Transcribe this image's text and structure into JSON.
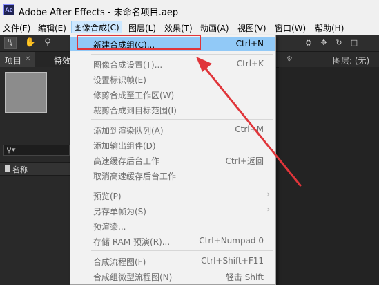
{
  "window": {
    "title": "Adobe After Effects - 未命名项目.aep",
    "app_icon": "Ae"
  },
  "menubar": [
    {
      "label": "文件(F)"
    },
    {
      "label": "编辑(E)"
    },
    {
      "label": "图像合成(C)"
    },
    {
      "label": "图层(L)"
    },
    {
      "label": "效果(T)"
    },
    {
      "label": "动画(A)"
    },
    {
      "label": "视图(V)"
    },
    {
      "label": "窗口(W)"
    },
    {
      "label": "帮助(H)"
    }
  ],
  "tabs": {
    "project": "项目",
    "effects": "特效",
    "layer": "图层: (无)"
  },
  "project_panel": {
    "search_icon": "search-icon",
    "column_name": "名称"
  },
  "menu": [
    {
      "label": "新建合成组(C)...",
      "shortcut": "Ctrl+N",
      "enabled": true,
      "highlight": true
    },
    {
      "label": "图像合成设置(T)...",
      "shortcut": "Ctrl+K",
      "enabled": false
    },
    {
      "label": "设置标识帧(E)",
      "shortcut": "",
      "enabled": false
    },
    {
      "label": "修剪合成至工作区(W)",
      "shortcut": "",
      "enabled": false
    },
    {
      "label": "裁剪合成到目标范围(I)",
      "shortcut": "",
      "enabled": false
    },
    {
      "label": "添加到渲染队列(A)",
      "shortcut": "Ctrl+M",
      "enabled": false
    },
    {
      "label": "添加输出组件(D)",
      "shortcut": "",
      "enabled": false
    },
    {
      "label": "高速缓存后台工作",
      "shortcut": "Ctrl+返回",
      "enabled": false
    },
    {
      "label": "取消高速缓存后台工作",
      "shortcut": "",
      "enabled": false
    },
    {
      "label": "预览(P)",
      "shortcut": "",
      "enabled": false,
      "submenu": true
    },
    {
      "label": "另存单帧为(S)",
      "shortcut": "",
      "enabled": false,
      "submenu": true
    },
    {
      "label": "预渲染...",
      "shortcut": "",
      "enabled": false
    },
    {
      "label": "存储 RAM 预演(R)...",
      "shortcut": "Ctrl+Numpad 0",
      "enabled": false
    },
    {
      "label": "合成流程图(F)",
      "shortcut": "Ctrl+Shift+F11",
      "enabled": false
    },
    {
      "label": "合成组微型流程图(N)",
      "shortcut": "轻击 Shift",
      "enabled": false
    }
  ],
  "colors": {
    "highlight": "#91c9f7",
    "annotation": "#e0353a",
    "panel_bg": "#232323"
  }
}
